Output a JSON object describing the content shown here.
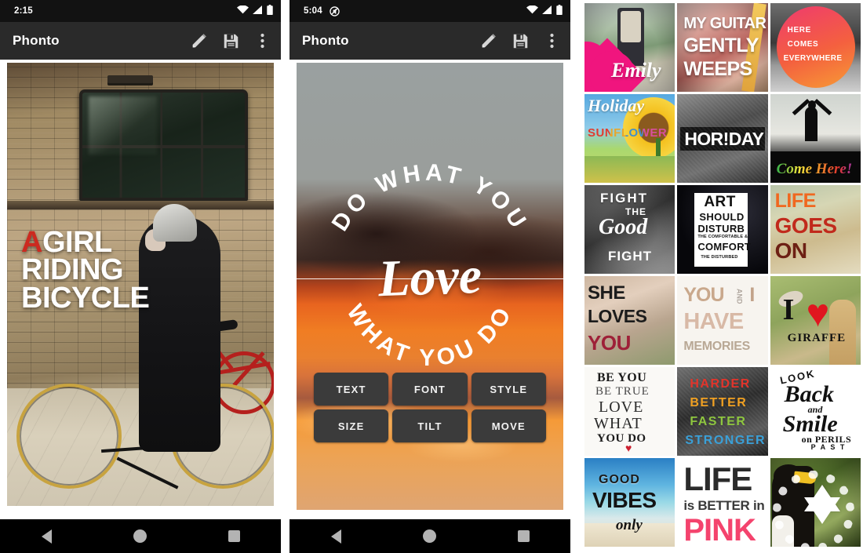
{
  "panels": [
    {
      "name": "editor-brick",
      "status": {
        "time": "2:15",
        "icons": [
          "wifi-icon",
          "signal-icon",
          "battery-icon"
        ]
      },
      "appbar": {
        "title": "Phonto",
        "actions": [
          "pencil-icon",
          "save-icon",
          "overflow-menu-icon"
        ]
      },
      "overlay_text": {
        "accent_word": "A",
        "line1_rest": "GIRL",
        "line2": "RIDING",
        "line3": "BICYCLE",
        "accent_color": "#cc2a20",
        "text_color": "#ffffff"
      },
      "navbar": [
        "back-icon",
        "home-icon",
        "recents-icon"
      ]
    },
    {
      "name": "editor-sunset",
      "status": {
        "time": "5:04",
        "icons": [
          "mute-icon",
          "wifi-icon",
          "signal-icon",
          "battery-icon"
        ]
      },
      "appbar": {
        "title": "Phonto",
        "actions": [
          "pencil-icon",
          "save-icon",
          "overflow-menu-icon"
        ]
      },
      "circle_text": {
        "top_arc": "DO WHAT YOU",
        "bottom_arc": "WHAT YOU DO",
        "center_script": "Love"
      },
      "buttons": [
        "TEXT",
        "FONT",
        "STYLE",
        "SIZE",
        "TILT",
        "MOVE"
      ],
      "navbar": [
        "back-icon",
        "home-icon",
        "recents-icon"
      ]
    }
  ],
  "gallery": {
    "name": "sample-gallery-grid",
    "tiles": [
      {
        "id": "emily",
        "lines": [
          "Emily"
        ],
        "note": "pink-heart"
      },
      {
        "id": "guitar",
        "lines": [
          "MY GUITAR",
          "GENTLY",
          "WEEPS"
        ]
      },
      {
        "id": "here",
        "lines": [
          "HERE",
          "COMES",
          "EVERYWHERE"
        ]
      },
      {
        "id": "sunflower",
        "lines": [
          "Holiday",
          "SUNFLOWER"
        ]
      },
      {
        "id": "horiday",
        "lines": [
          "HOR!DAY"
        ]
      },
      {
        "id": "comehere",
        "lines": [
          "Come Here!"
        ]
      },
      {
        "id": "fight",
        "lines": [
          "FIGHT",
          "THE",
          "Good",
          "FIGHT"
        ]
      },
      {
        "id": "art",
        "lines": [
          "ART",
          "SHOULD",
          "DISTURB",
          "THE COMFORTABLE &",
          "COMFORT",
          "THE DISTURBED"
        ]
      },
      {
        "id": "life",
        "lines": [
          "LIFE",
          "GOES",
          "ON"
        ]
      },
      {
        "id": "she",
        "lines": [
          "SHE",
          "LOVES",
          "YOU"
        ]
      },
      {
        "id": "memories",
        "lines": [
          "YOU",
          "AND",
          "I",
          "HAVE",
          "MEMORIES"
        ]
      },
      {
        "id": "giraffe",
        "lines": [
          "I",
          "GIRAFFE"
        ],
        "note": "red-heart"
      },
      {
        "id": "beyou",
        "lines": [
          "BE YOU",
          "BE TRUE",
          "LOVE",
          "WHAT",
          "YOU DO"
        ],
        "note": "red-heart"
      },
      {
        "id": "harder",
        "lines": [
          "HARDER",
          "BETTER",
          "FASTER",
          "STRONGER"
        ]
      },
      {
        "id": "look",
        "lines": [
          "LOOK",
          "Back",
          "and",
          "Smile",
          "on PERILS",
          "P A S T"
        ]
      },
      {
        "id": "good",
        "lines": [
          "GOOD",
          "VIBES",
          "only"
        ]
      },
      {
        "id": "pink",
        "lines": [
          "LIFE",
          "is BETTER in",
          "PINK"
        ]
      },
      {
        "id": "eagle",
        "lines": [],
        "note": "star-badge"
      }
    ]
  }
}
